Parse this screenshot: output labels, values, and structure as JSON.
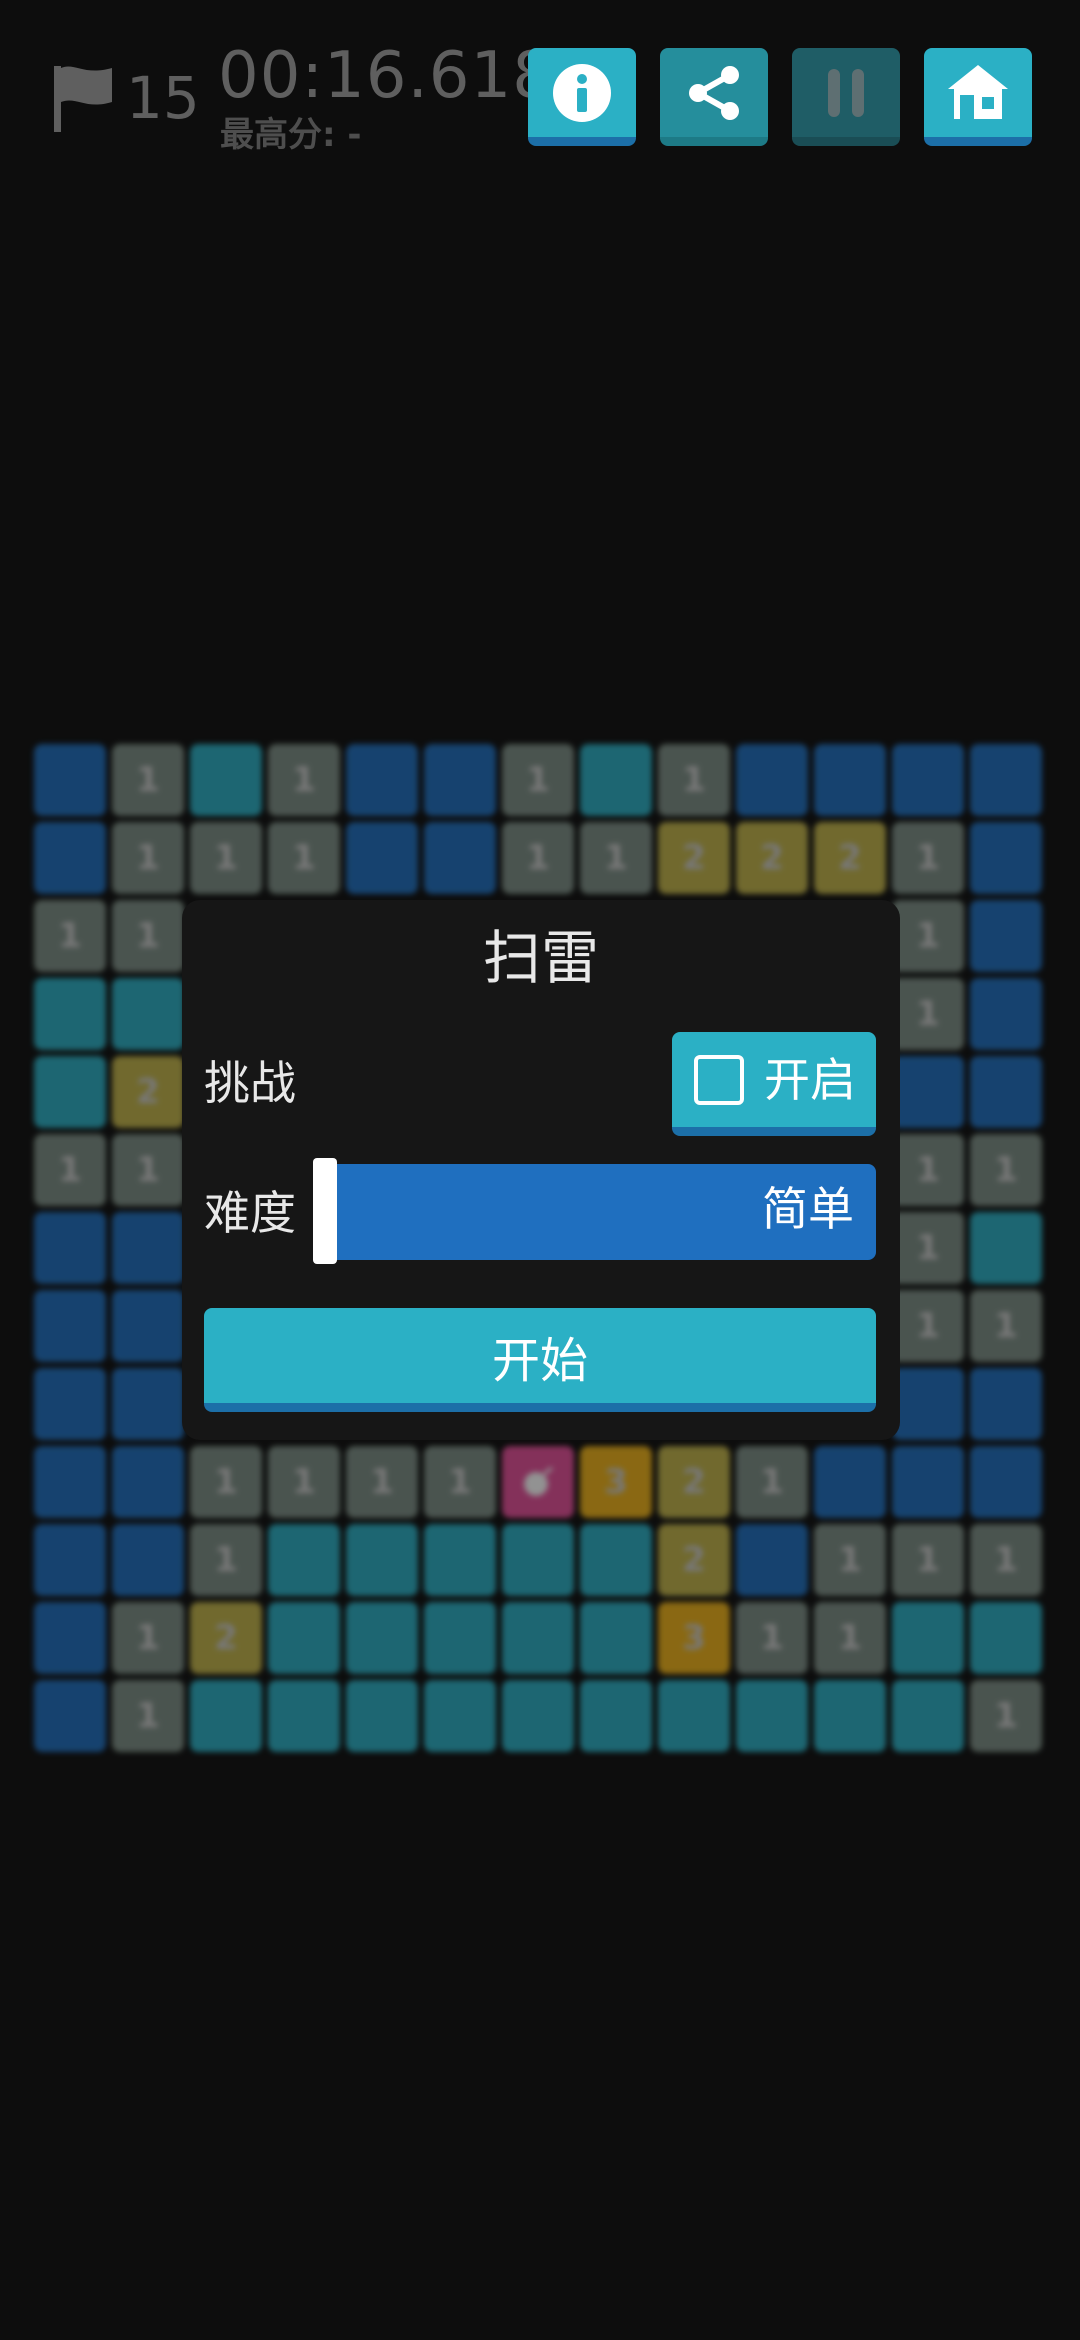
{
  "header": {
    "flag_count": "15",
    "timer": "00:16.618",
    "best_score": "最高分: -"
  },
  "toolbar": {
    "info_icon": "info-icon",
    "share_icon": "share-icon",
    "pause_icon": "pause-icon",
    "home_icon": "home-icon"
  },
  "dialog": {
    "title": "扫雷",
    "challenge_label": "挑战",
    "challenge_toggle_label": "开启",
    "challenge_checked": false,
    "difficulty_label": "难度",
    "difficulty_value": "简单",
    "difficulty_level": 0.0,
    "start_label": "开始"
  },
  "colors": {
    "accent": "#2bb0c5",
    "accent_shadow": "#1c6fa8",
    "hidden_cell": "#1f6fbf",
    "revealed_cell": "#7d8f86",
    "number_two_cell": "#c3b54a",
    "number_three_cell": "#f0b419",
    "mine_cell": "#e64f9a",
    "background": "#0d0d0d"
  },
  "board": {
    "rows": [
      [
        "b",
        "g1",
        "t",
        "g1",
        "b",
        "b",
        "g1",
        "t",
        "g1",
        "b",
        "b",
        "b",
        "b"
      ],
      [
        "b",
        "g1",
        "g1",
        "g1",
        "b",
        "b",
        "g1",
        "g1",
        "y2",
        "y2",
        "y2",
        "g1",
        "b"
      ],
      [
        "g1",
        "g1",
        "x",
        "x",
        "x",
        "x",
        "x",
        "x",
        "x",
        "x",
        "x",
        "g1",
        "b"
      ],
      [
        "t",
        "t",
        "x",
        "x",
        "x",
        "x",
        "x",
        "x",
        "x",
        "x",
        "x",
        "g1",
        "b"
      ],
      [
        "t",
        "y2",
        "x",
        "x",
        "x",
        "x",
        "x",
        "x",
        "x",
        "x",
        "x",
        "b",
        "b"
      ],
      [
        "g1",
        "g1",
        "x",
        "x",
        "x",
        "x",
        "x",
        "x",
        "x",
        "x",
        "x",
        "g1",
        "g1"
      ],
      [
        "b",
        "b",
        "x",
        "x",
        "x",
        "x",
        "x",
        "x",
        "x",
        "x",
        "x",
        "g1",
        "t"
      ],
      [
        "b",
        "b",
        "x",
        "x",
        "x",
        "x",
        "x",
        "x",
        "x",
        "x",
        "x",
        "g1",
        "g1"
      ],
      [
        "b",
        "b",
        "x",
        "x",
        "x",
        "x",
        "x",
        "x",
        "x",
        "x",
        "x",
        "b",
        "b"
      ],
      [
        "b",
        "b",
        "g1",
        "g1",
        "g1",
        "g1",
        "p",
        "o3",
        "y2",
        "g1",
        "b",
        "b",
        "b"
      ],
      [
        "b",
        "b",
        "g1",
        "t",
        "t",
        "t",
        "t",
        "t",
        "y2",
        "b",
        "g1",
        "g1",
        "g1"
      ],
      [
        "b",
        "g1",
        "y2",
        "t",
        "t",
        "t",
        "t",
        "t",
        "o3",
        "g1",
        "g1",
        "t",
        "t"
      ],
      [
        "b",
        "g1",
        "t",
        "t",
        "t",
        "t",
        "t",
        "t",
        "t",
        "t",
        "t",
        "t",
        "g1"
      ]
    ]
  }
}
